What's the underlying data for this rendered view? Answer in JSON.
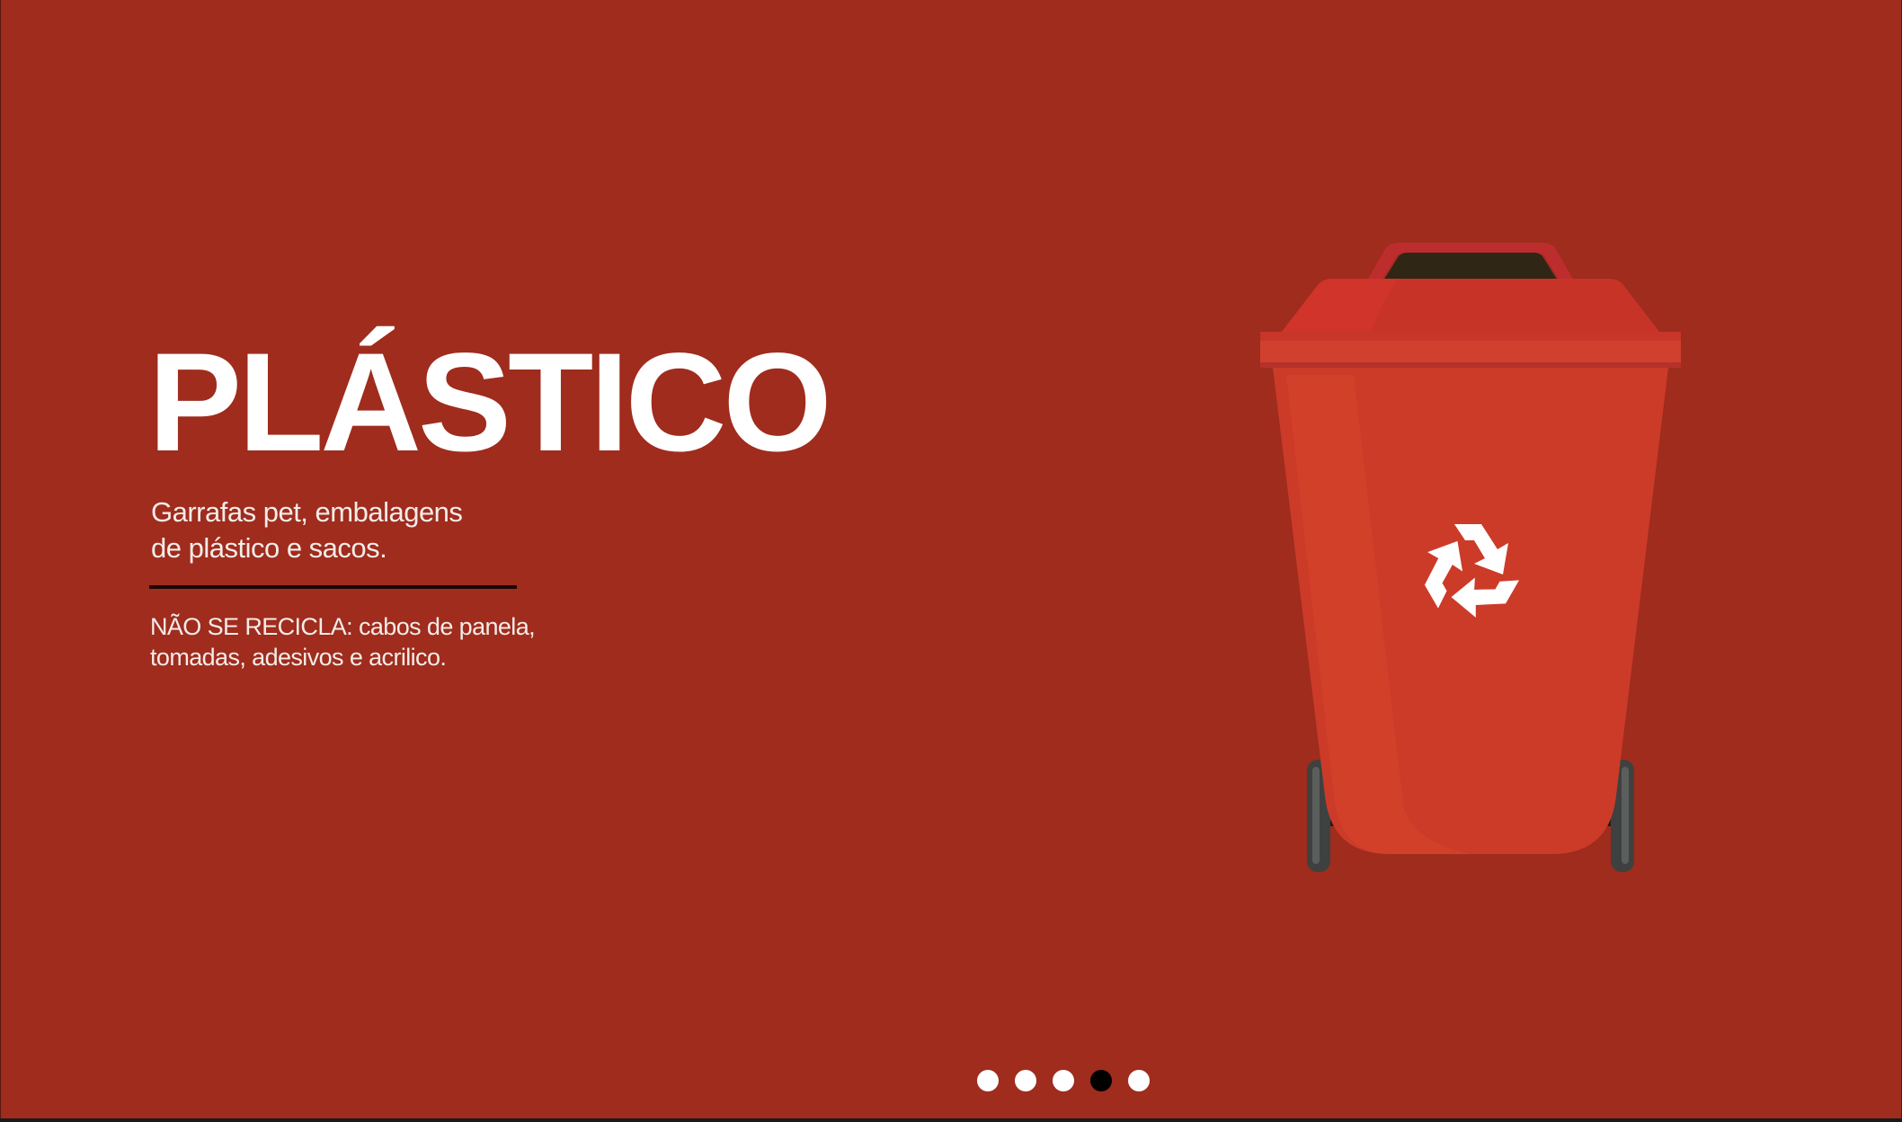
{
  "slide": {
    "title": "PLÁSTICO",
    "description_line1": "Garrafas pet, embalagens",
    "description_line2": "de plástico e sacos.",
    "not_recycled_line1": "NÃO SE RECICLA: cabos de panela,",
    "not_recycled_line2": "tomadas, adesivos e acrilico.",
    "background_color": "#9f2c1d",
    "bin_color": "#cf3a26",
    "bin_icon": "recycle-icon"
  },
  "pagination": {
    "total": 5,
    "active_index": 3
  }
}
